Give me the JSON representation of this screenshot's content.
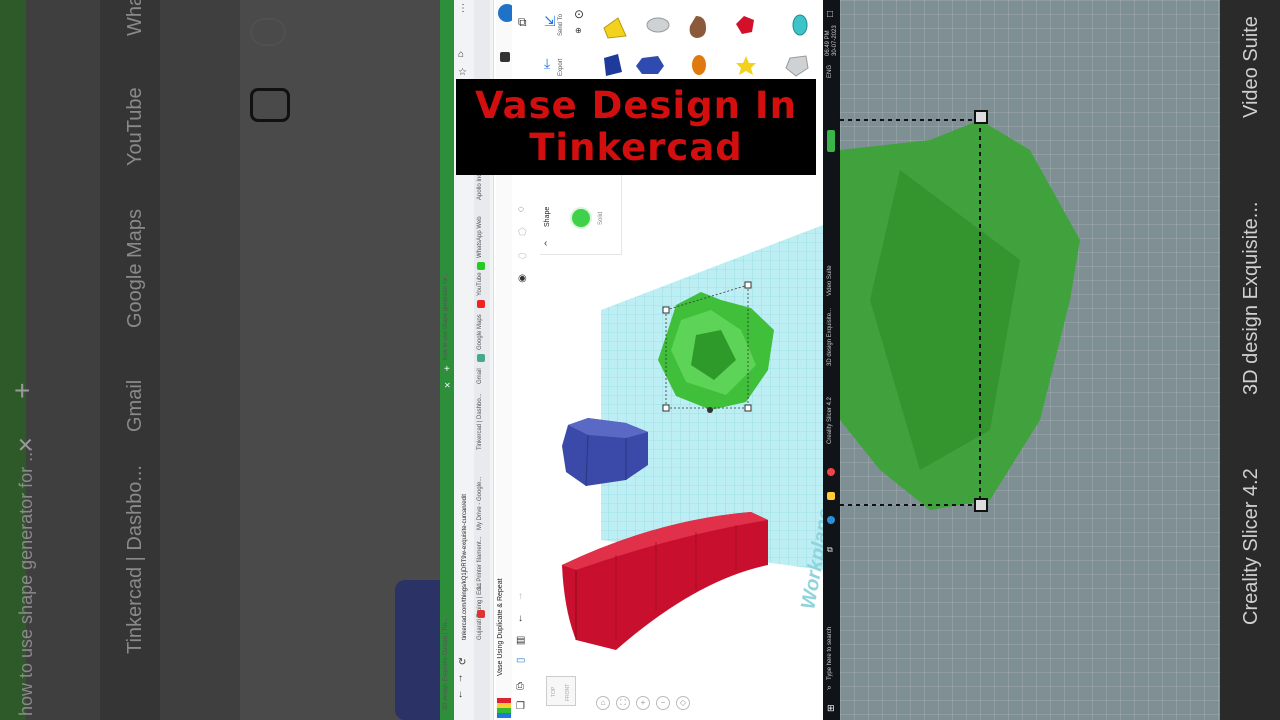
{
  "banner": {
    "line1": "Vase Design In",
    "line2": "Tinkercad"
  },
  "left_background": {
    "items": [
      "WhatsApp",
      "YouTube",
      "Google Maps",
      "Gmail",
      "Tinkercad | Dashbo...",
      "how to use shape generator for ..."
    ]
  },
  "right_background": {
    "items": [
      "Video Suite",
      "3D design Exquisite...",
      "Creality Slicer 4.2"
    ]
  },
  "browser": {
    "address": "tinkercad.com/things/kQ1jDRT9w-exquisite-curcan/edit",
    "tab_active": "3D design Exquisite Curcan | Tin...",
    "tab_other": "how to use shape generator for...",
    "bookmarks": [
      "Gujarati Typing | En...",
      "3d Printer filament...",
      "My Drive - Google...",
      "Tinkercad | Dashbo...",
      "Gmail",
      "Google Maps",
      "YouTube",
      "WhatsApp Web",
      "Apollo Inc"
    ],
    "page_heading": "Vase Using Duplicate & Repeat"
  },
  "toolbar": {
    "send_to": "Send To",
    "export": "Export"
  },
  "shape_panel": {
    "title": "Shape",
    "solid_label": "Solid"
  },
  "workplane": {
    "label": "Workplane",
    "view_top": "TOP",
    "view_front": "FRONT"
  },
  "taskbar": {
    "search": "Type here to search",
    "time": "06:49 PM",
    "date": "30-07-2023",
    "lang": "ENG",
    "items": [
      "Video Suite",
      "3D design Exquisite...",
      "Creality Slicer 4.2"
    ]
  },
  "colors": {
    "banner_text": "#d30e0e",
    "vase_green": "#3fbf3a",
    "hex_blue": "#3b4aa8",
    "twist_red": "#c8102e",
    "grid": "#a8e6ee"
  }
}
